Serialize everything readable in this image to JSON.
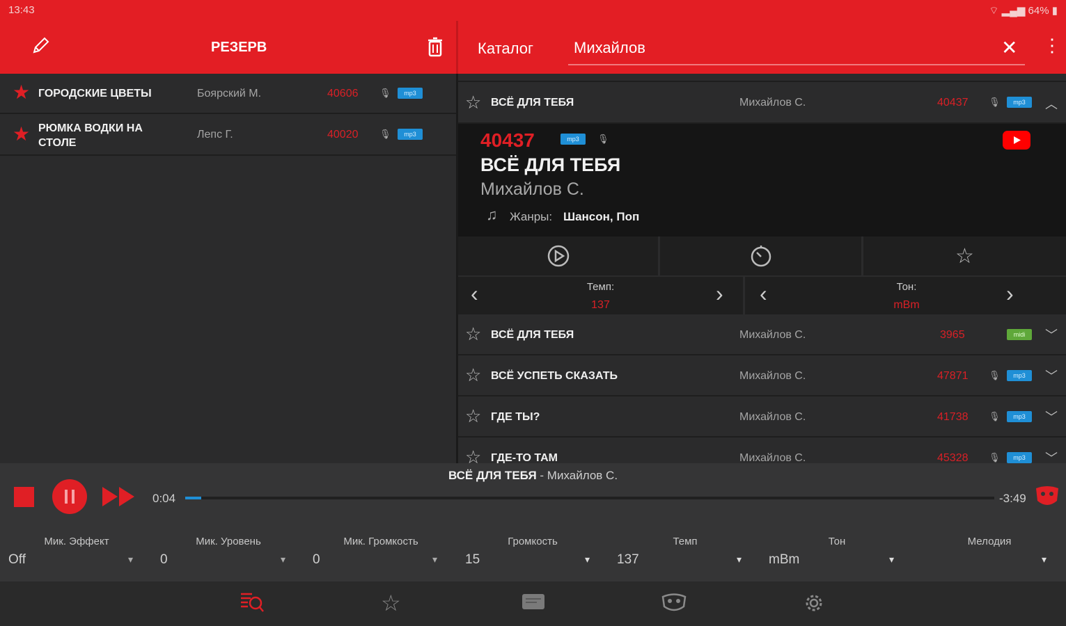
{
  "status": {
    "time": "13:43",
    "battery": "64%"
  },
  "left_header": {
    "title": "РЕЗЕРВ"
  },
  "right_header": {
    "tab": "Каталог",
    "search_value": "Михайлов"
  },
  "reserve": [
    {
      "title": "ГОРОДСКИЕ ЦВЕТЫ",
      "artist": "Боярский М.",
      "number": "40606",
      "format": "mp3"
    },
    {
      "title": "РЮМКА ВОДКИ НА СТОЛЕ",
      "artist": "Лепс Г.",
      "number": "40020",
      "format": "mp3"
    }
  ],
  "catalog": {
    "expanded": {
      "title": "ВСЁ ДЛЯ ТЕБЯ",
      "artist": "Михайлов С.",
      "number": "40437",
      "format": "mp3"
    },
    "detail": {
      "number": "40437",
      "format": "mp3",
      "title": "ВСЁ ДЛЯ ТЕБЯ",
      "artist": "Михайлов С.",
      "genre_label": "Жанры:",
      "genres": "Шансон, Поп"
    },
    "tempo": {
      "label": "Темп:",
      "value": "137"
    },
    "key": {
      "label": "Тон:",
      "value": "mBm"
    },
    "rows": [
      {
        "title": "ВСЁ ДЛЯ ТЕБЯ",
        "artist": "Михайлов С.",
        "number": "3965",
        "format": "midi"
      },
      {
        "title": "ВСЁ УСПЕТЬ СКАЗАТЬ",
        "artist": "Михайлов С.",
        "number": "47871",
        "format": "mp3"
      },
      {
        "title": "ГДЕ ТЫ?",
        "artist": "Михайлов С.",
        "number": "41738",
        "format": "mp3"
      },
      {
        "title": "ГДЕ-ТО ТАМ",
        "artist": "Михайлов С.",
        "number": "45328",
        "format": "mp3"
      }
    ]
  },
  "player": {
    "now_title": "ВСЁ ДЛЯ ТЕБЯ",
    "now_artist": "- Михайлов С.",
    "elapsed": "0:04",
    "remaining": "-3:49",
    "progress": 0.02
  },
  "controls": [
    {
      "label": "Мик. Эффект",
      "value": "Off"
    },
    {
      "label": "Мик. Уровень",
      "value": "0"
    },
    {
      "label": "Мик. Громкость",
      "value": "0"
    },
    {
      "label": "Громкость",
      "value": "15"
    },
    {
      "label": "Темп",
      "value": "137"
    },
    {
      "label": "Тон",
      "value": "mBm"
    },
    {
      "label": "Мелодия",
      "value": ""
    }
  ],
  "colors": {
    "accent": "#e31e24",
    "background": "#2b2b2c"
  },
  "icons": [
    "pencil-icon",
    "trash-icon",
    "close-icon",
    "more-icon",
    "youtube-icon",
    "play-circle-icon",
    "timer-icon",
    "star-icon",
    "playlist-icon",
    "catalog-icon",
    "mask-icon",
    "settings-icon"
  ]
}
